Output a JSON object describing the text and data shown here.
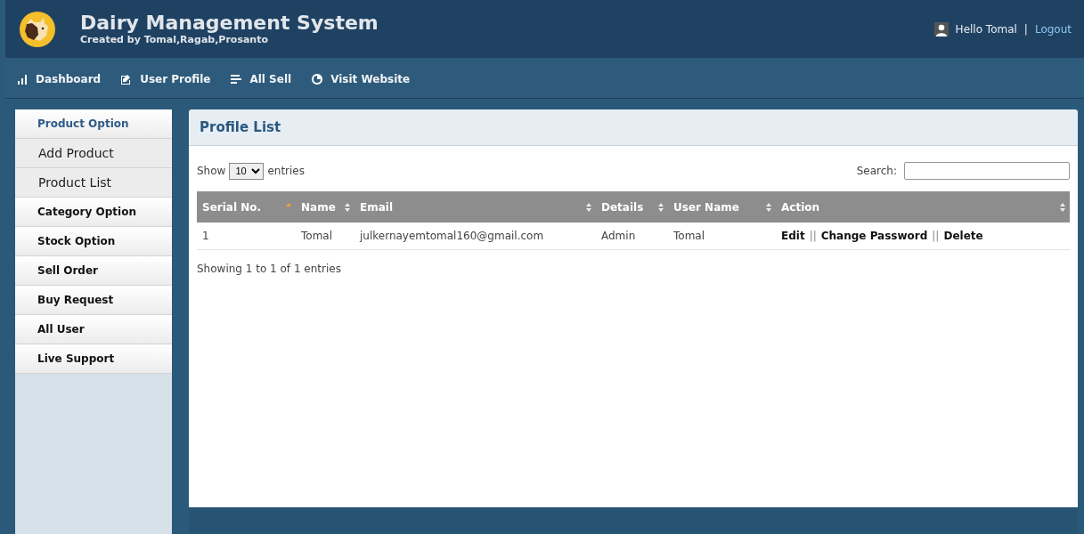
{
  "header": {
    "title": "Dairy Management System",
    "subtitle": "Created by Tomal,Ragab,Prosanto",
    "greeting": "Hello Tomal",
    "separator": "|",
    "logout": "Logout"
  },
  "nav": [
    {
      "label": "Dashboard"
    },
    {
      "label": "User Profile"
    },
    {
      "label": "All Sell"
    },
    {
      "label": "Visit Website"
    }
  ],
  "sidebar": [
    {
      "kind": "section",
      "label": "Product Option",
      "expanded": true
    },
    {
      "kind": "item",
      "label": "Add Product"
    },
    {
      "kind": "item",
      "label": "Product List"
    },
    {
      "kind": "section",
      "label": "Category Option",
      "expanded": false
    },
    {
      "kind": "section",
      "label": "Stock Option",
      "expanded": false
    },
    {
      "kind": "section",
      "label": "Sell Order",
      "expanded": false
    },
    {
      "kind": "section",
      "label": "Buy Request",
      "expanded": false
    },
    {
      "kind": "section",
      "label": "All User",
      "expanded": false
    },
    {
      "kind": "section",
      "label": "Live Support",
      "expanded": false
    }
  ],
  "panel": {
    "title": "Profile List",
    "show_label": "Show",
    "page_size": "10",
    "entries_label": "entries",
    "search_label": "Search:",
    "table": {
      "columns": [
        {
          "label": "Serial No.",
          "sorted": true
        },
        {
          "label": "Name",
          "sorted": false
        },
        {
          "label": "Email",
          "sorted": false
        },
        {
          "label": "Details",
          "sorted": false
        },
        {
          "label": "User Name",
          "sorted": false
        },
        {
          "label": "Action",
          "sorted": false
        }
      ],
      "rows": [
        {
          "cells": [
            "1",
            "Tomal",
            "julkernayemtomal160@gmail.com",
            "Admin",
            "Tomal"
          ],
          "actions": [
            {
              "kind": "link",
              "text": "Edit"
            },
            {
              "kind": "separator",
              "text": "||"
            },
            {
              "kind": "link",
              "text": "Change Password"
            },
            {
              "kind": "separator",
              "text": "||"
            },
            {
              "kind": "link",
              "text": "Delete"
            }
          ]
        }
      ]
    },
    "info": "Showing 1 to 1 of 1 entries"
  }
}
